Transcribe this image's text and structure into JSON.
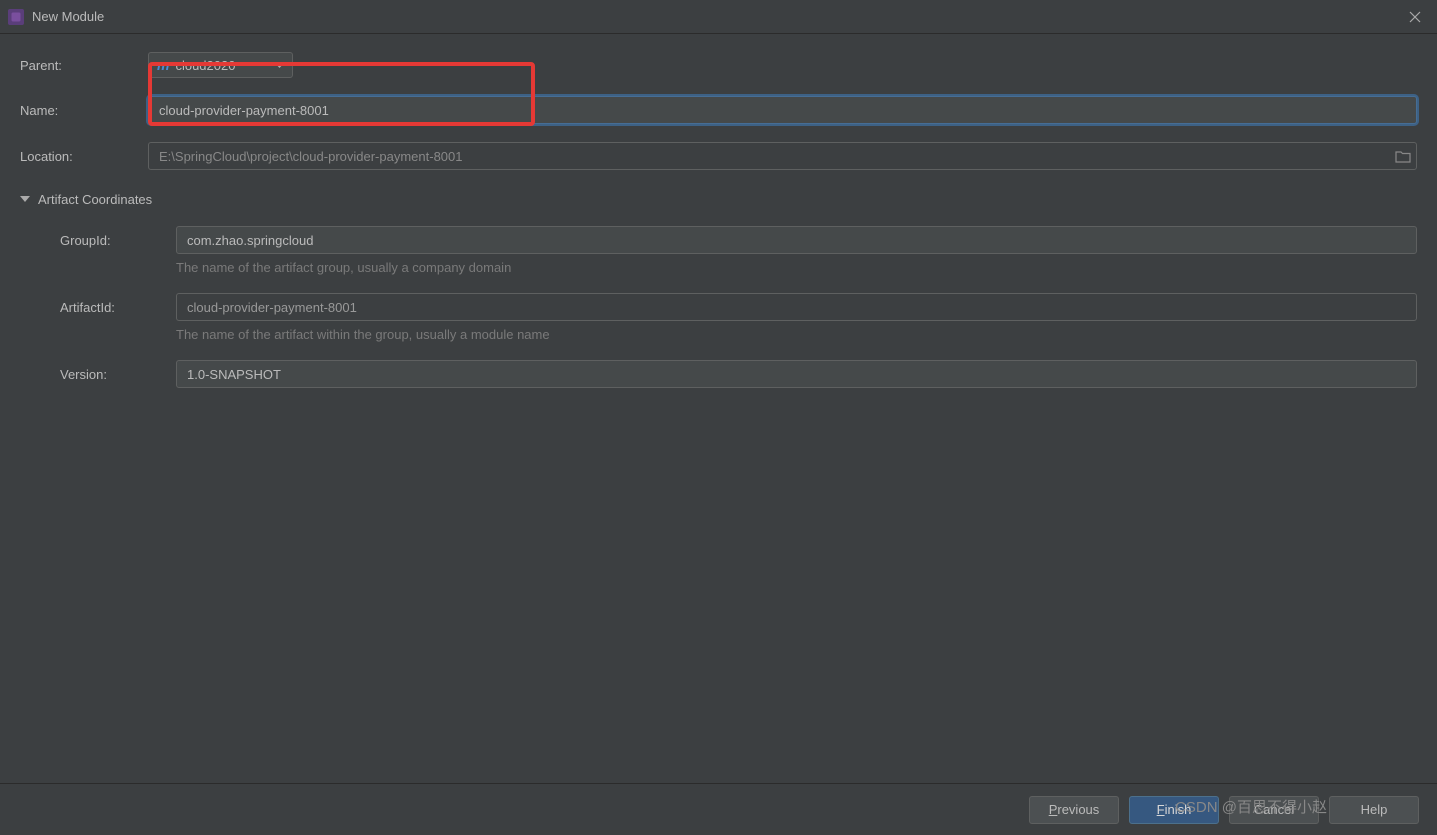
{
  "titlebar": {
    "title": "New Module"
  },
  "form": {
    "parent": {
      "label": "Parent:",
      "value": "cloud2020"
    },
    "name": {
      "label": "Name:",
      "value": "cloud-provider-payment-8001"
    },
    "location": {
      "label": "Location:",
      "value": "E:\\SpringCloud\\project\\cloud-provider-payment-8001"
    }
  },
  "artifact": {
    "section_title": "Artifact Coordinates",
    "groupId": {
      "label": "GroupId:",
      "value": "com.zhao.springcloud",
      "help": "The name of the artifact group, usually a company domain"
    },
    "artifactId": {
      "label": "ArtifactId:",
      "value": "cloud-provider-payment-8001",
      "help": "The name of the artifact within the group, usually a module name"
    },
    "version": {
      "label": "Version:",
      "value": "1.0-SNAPSHOT"
    }
  },
  "buttons": {
    "previous": "Previous",
    "finish": "Finish",
    "cancel": "Cancel",
    "help": "Help"
  },
  "watermark": "CSDN @百思不得小赵"
}
